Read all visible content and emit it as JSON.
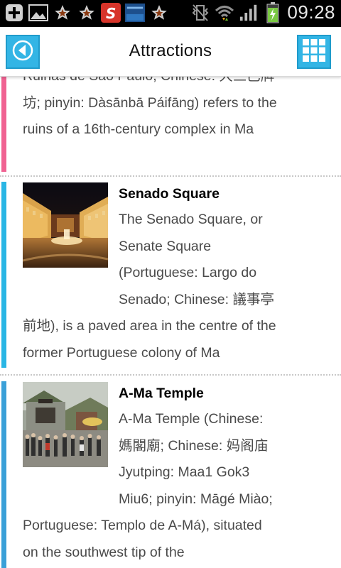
{
  "status_bar": {
    "time": "09:28",
    "icons": [
      "add-icon",
      "image-icon",
      "star-icon",
      "star-icon",
      "s-app-icon",
      "news-app-icon",
      "star-icon",
      "vibrate-off-icon",
      "wifi-icon",
      "signal-icon",
      "battery-charging-icon"
    ]
  },
  "app_bar": {
    "title": "Attractions",
    "back_icon": "back-arrow-icon",
    "grid_icon": "grid-icon",
    "accent": "#33b5e5"
  },
  "items": [
    {
      "partial_first_line": "Ruinas de São Paulo, Chinese: 大三巴牌",
      "text": "坊; pinyin: Dàsānbā Páifāng) refers to the ruins of a 16th-century complex in Ma",
      "bar_color": "#f06292"
    },
    {
      "title": "Senado Square",
      "text": "The Senado Square, or Senate Square (Portuguese: Largo do Senado; Chinese: 議事亭前地), is a paved area in the centre of the former Portuguese colony of Ma",
      "bar_color": "#29b6e5",
      "image": "senado-square-photo"
    },
    {
      "title": "A-Ma Temple",
      "text": "A-Ma Temple (Chinese: 媽閣廟; Chinese: 妈阁庙 Jyutping: Maa1 Gok3 Miu6; pinyin: Māgé Miào; Portuguese: Templo de A-Má), situated on the southwest tip of the",
      "bar_color": "#3aa0d8",
      "image": "a-ma-temple-photo"
    }
  ]
}
